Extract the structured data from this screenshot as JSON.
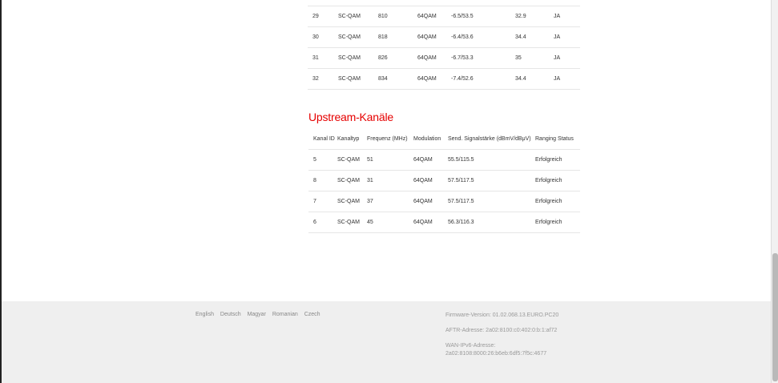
{
  "downstream": {
    "rows": [
      [
        "29",
        "SC-QAM",
        "810",
        "64QAM",
        "-6.5/53.5",
        "32.9",
        "JA"
      ],
      [
        "30",
        "SC-QAM",
        "818",
        "64QAM",
        "-6.4/53.6",
        "34.4",
        "JA"
      ],
      [
        "31",
        "SC-QAM",
        "826",
        "64QAM",
        "-6.7/53.3",
        "35",
        "JA"
      ],
      [
        "32",
        "SC-QAM",
        "834",
        "64QAM",
        "-7.4/52.6",
        "34.4",
        "JA"
      ]
    ]
  },
  "upstream": {
    "title": "Upstream-Kanäle",
    "headers": [
      "Kanal ID",
      "Kanaltyp",
      "Frequenz (MHz)",
      "Modulation",
      "Send. Signalstärke (dBmV/dBμV)",
      "Ranging Status"
    ],
    "rows": [
      [
        "5",
        "SC-QAM",
        "51",
        "64QAM",
        "55.5/115.5",
        "Erfolgreich"
      ],
      [
        "8",
        "SC-QAM",
        "31",
        "64QAM",
        "57.5/117.5",
        "Erfolgreich"
      ],
      [
        "7",
        "SC-QAM",
        "37",
        "64QAM",
        "57.5/117.5",
        "Erfolgreich"
      ],
      [
        "6",
        "SC-QAM",
        "45",
        "64QAM",
        "56.3/116.3",
        "Erfolgreich"
      ]
    ]
  },
  "footer": {
    "languages": [
      "English",
      "Deutsch",
      "Magyar",
      "Romanian",
      "Czech"
    ],
    "firmware": "Firmware-Version: 01.02.068.13.EURO.PC20",
    "aftr": "AFTR-Adresse: 2a02:8100:c0:402:0:b:1:af72",
    "wan_label": "WAN-IPv6-Adresse:",
    "wan_value": "2a02:8108:8000:26:b6eb:6df5:7f5c:4677"
  },
  "colors": {
    "accent": "#e60000",
    "footer_bg": "#efefef"
  }
}
